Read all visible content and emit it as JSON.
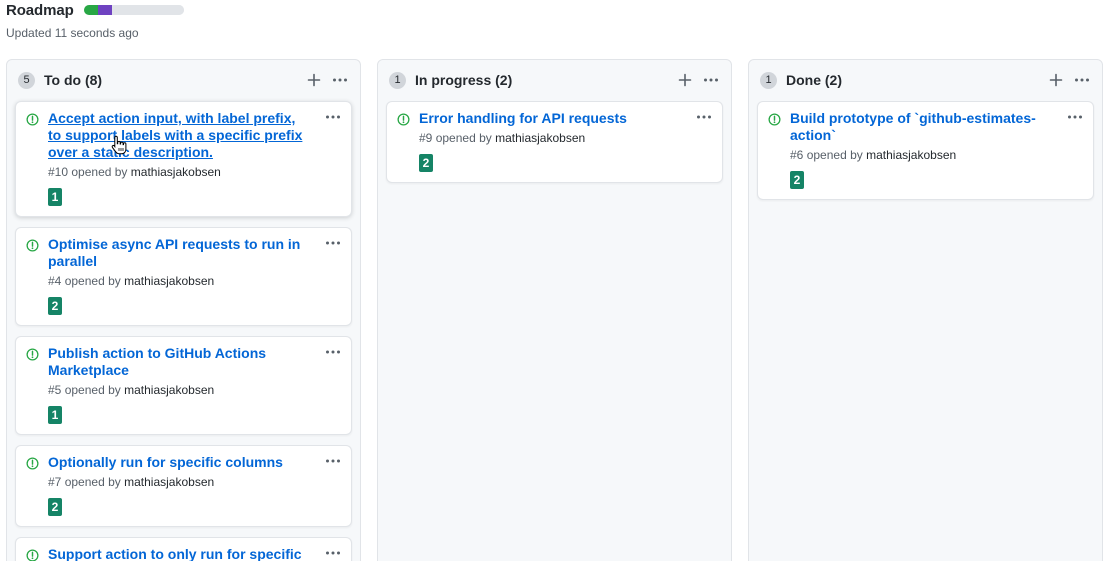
{
  "header": {
    "title": "Roadmap",
    "updated": "Updated 11 seconds ago",
    "progress": [
      {
        "name": "done",
        "fraction": 0.14,
        "color": "#28a745"
      },
      {
        "name": "in_progress",
        "fraction": 0.14,
        "color": "#6f42c1"
      },
      {
        "name": "todo",
        "fraction": 0.72,
        "color": "#e1e4e8"
      }
    ]
  },
  "colors": {
    "link": "#0366d6",
    "open_issue": "#28a745",
    "label_bg": "#158466",
    "column_bg": "#f6f8fa"
  },
  "columns": [
    {
      "count": "5",
      "title": "To do (8)",
      "add_icon": "plus-icon",
      "menu_icon": "kebab-horizontal-icon",
      "cards": [
        {
          "title": "Accept action input, with label prefix, to support labels with a specific prefix over a static description.",
          "number": "#10",
          "opened_by": "opened by",
          "author": "mathiasjakobsen",
          "label": "1"
        },
        {
          "title": "Optimise async API requests to run in parallel",
          "number": "#4",
          "opened_by": "opened by",
          "author": "mathiasjakobsen",
          "label": "2"
        },
        {
          "title": "Publish action to GitHub Actions Marketplace",
          "number": "#5",
          "opened_by": "opened by",
          "author": "mathiasjakobsen",
          "label": "1"
        },
        {
          "title": "Optionally run for specific columns",
          "number": "#7",
          "opened_by": "opened by",
          "author": "mathiasjakobsen",
          "label": "2"
        },
        {
          "title": "Support action to only run for specific",
          "number": "",
          "opened_by": "",
          "author": "",
          "label": ""
        }
      ]
    },
    {
      "count": "1",
      "title": "In progress (2)",
      "add_icon": "plus-icon",
      "menu_icon": "kebab-horizontal-icon",
      "cards": [
        {
          "title": "Error handling for API requests",
          "number": "#9",
          "opened_by": "opened by",
          "author": "mathiasjakobsen",
          "label": "2"
        }
      ]
    },
    {
      "count": "1",
      "title": "Done (2)",
      "add_icon": "plus-icon",
      "menu_icon": "kebab-horizontal-icon",
      "cards": [
        {
          "title": "Build prototype of `github-estimates-action`",
          "number": "#6",
          "opened_by": "opened by",
          "author": "mathiasjakobsen",
          "label": "2"
        }
      ]
    }
  ]
}
